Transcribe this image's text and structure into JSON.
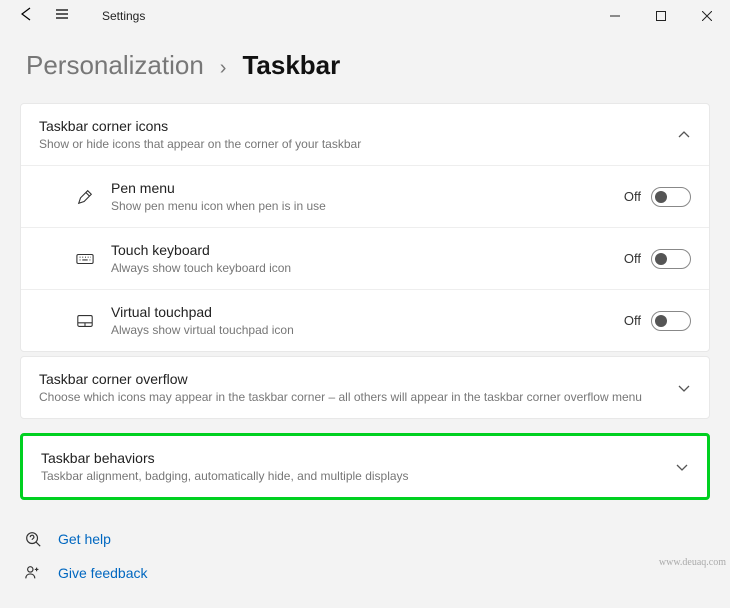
{
  "app": {
    "title": "Settings"
  },
  "breadcrumb": {
    "parent": "Personalization",
    "separator": "›",
    "current": "Taskbar"
  },
  "sections": {
    "corner_icons": {
      "title": "Taskbar corner icons",
      "subtitle": "Show or hide icons that appear on the corner of your taskbar",
      "items": [
        {
          "title": "Pen menu",
          "subtitle": "Show pen menu icon when pen is in use",
          "state_label": "Off",
          "state": false
        },
        {
          "title": "Touch keyboard",
          "subtitle": "Always show touch keyboard icon",
          "state_label": "Off",
          "state": false
        },
        {
          "title": "Virtual touchpad",
          "subtitle": "Always show virtual touchpad icon",
          "state_label": "Off",
          "state": false
        }
      ]
    },
    "corner_overflow": {
      "title": "Taskbar corner overflow",
      "subtitle": "Choose which icons may appear in the taskbar corner – all others will appear in the taskbar corner overflow menu"
    },
    "behaviors": {
      "title": "Taskbar behaviors",
      "subtitle": "Taskbar alignment, badging, automatically hide, and multiple displays"
    }
  },
  "footer": {
    "help": "Get help",
    "feedback": "Give feedback"
  },
  "watermark": "www.deuaq.com"
}
